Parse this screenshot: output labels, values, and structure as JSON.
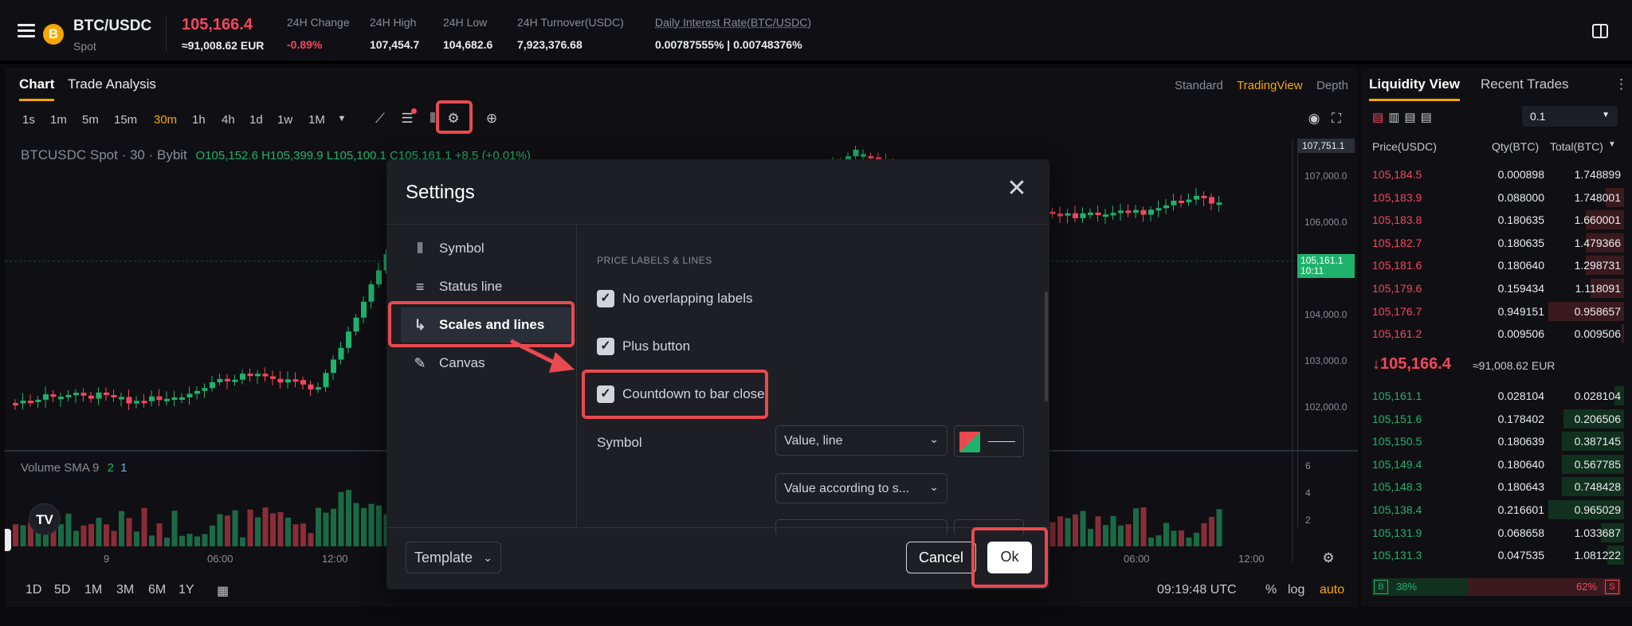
{
  "header": {
    "coin_icon": "B",
    "pair": "BTC/USDC",
    "market": "Spot",
    "price": "105,166.4",
    "price_eur": "≈91,008.62 EUR",
    "stats": [
      {
        "label": "24H Change",
        "value": "-0.89%",
        "color": "#f6465d"
      },
      {
        "label": "24H High",
        "value": "107,454.7",
        "color": "#eaecef"
      },
      {
        "label": "24H Low",
        "value": "104,682.6",
        "color": "#eaecef"
      },
      {
        "label": "24H Turnover(USDC)",
        "value": "7,923,376.68",
        "color": "#eaecef"
      },
      {
        "label": "Daily Interest Rate(BTC/USDC)",
        "value": "0.00787555% | 0.00748376%",
        "color": "#eaecef"
      }
    ]
  },
  "chart": {
    "tabs": [
      "Chart",
      "Trade Analysis"
    ],
    "views": [
      "Standard",
      "TradingView",
      "Depth"
    ],
    "active_view": "TradingView",
    "timeframes": [
      "1s",
      "1m",
      "5m",
      "15m",
      "30m",
      "1h",
      "4h",
      "1d",
      "1w",
      "1M"
    ],
    "active_timeframe": "30m",
    "legend": {
      "symbol": "BTCUSDC Spot · 30 · Bybit",
      "ohlc": "O105,152.6 H105,399.9 L105,100.1 C105,161.1 +8.5 (+0.01%)"
    },
    "price_ticks": [
      "107,000.0",
      "106,000.0",
      "104,000.0",
      "103,000.0",
      "102,000.0"
    ],
    "top_tag": "107,751.1",
    "current_tag_price": "105,161.1",
    "current_tag_time": "10:11",
    "volume_legend": {
      "name": "Volume SMA 9",
      "v1": "2",
      "v2": "1"
    },
    "volume_ticks": [
      "6",
      "4",
      "2"
    ],
    "time_labels": [
      "9",
      "06:00",
      "12:00",
      "06:00",
      "12:00"
    ],
    "ranges": [
      "1D",
      "5D",
      "1M",
      "3M",
      "6M",
      "1Y"
    ],
    "clock": "09:19:48 UTC",
    "scale_options": [
      "%",
      "log",
      "auto"
    ],
    "active_scale": "auto",
    "logo": "TV"
  },
  "settings_modal": {
    "title": "Settings",
    "nav": [
      {
        "label": "Symbol",
        "icon": "candles-icon"
      },
      {
        "label": "Status line",
        "icon": "lines-icon"
      },
      {
        "label": "Scales and lines",
        "icon": "axes-icon"
      },
      {
        "label": "Canvas",
        "icon": "pencil-icon"
      }
    ],
    "active_nav": "Scales and lines",
    "section_title": "PRICE LABELS & LINES",
    "checkboxes": [
      {
        "label": "No overlapping labels",
        "checked": true
      },
      {
        "label": "Plus button",
        "checked": true
      },
      {
        "label": "Countdown to bar close",
        "checked": true
      }
    ],
    "symbol_label": "Symbol",
    "symbol_select": "Value, line",
    "symbol_select2": "Value according to s...",
    "template_label": "Template",
    "cancel_label": "Cancel",
    "ok_label": "Ok"
  },
  "orderbook": {
    "tabs": [
      "Liquidity View",
      "Recent Trades"
    ],
    "precision": "0.1",
    "headers": [
      "Price(USDC)",
      "Qty(BTC)",
      "Total(BTC)"
    ],
    "asks": [
      {
        "price": "105,184.5",
        "qty": "0.000898",
        "total": "1.748899",
        "depth": 0.0
      },
      {
        "price": "105,183.9",
        "qty": "0.088000",
        "total": "1.748001",
        "depth": 0.24
      },
      {
        "price": "105,183.8",
        "qty": "0.180635",
        "total": "1.660001",
        "depth": 0.5
      },
      {
        "price": "105,182.7",
        "qty": "0.180635",
        "total": "1.479366",
        "depth": 0.5
      },
      {
        "price": "105,181.6",
        "qty": "0.180640",
        "total": "1.298731",
        "depth": 0.5
      },
      {
        "price": "105,179.6",
        "qty": "0.159434",
        "total": "1.118091",
        "depth": 0.44
      },
      {
        "price": "105,176.7",
        "qty": "0.949151",
        "total": "0.958657",
        "depth": 1.0
      },
      {
        "price": "105,161.2",
        "qty": "0.009506",
        "total": "0.009506",
        "depth": 0.03
      }
    ],
    "mid_price": "↓105,166.4",
    "mid_eur": "≈91,008.62 EUR",
    "bids": [
      {
        "price": "105,161.1",
        "qty": "0.028104",
        "total": "0.028104",
        "depth": 0.13
      },
      {
        "price": "105,151.6",
        "qty": "0.178402",
        "total": "0.206506",
        "depth": 0.8
      },
      {
        "price": "105,150.5",
        "qty": "0.180639",
        "total": "0.387145",
        "depth": 0.82
      },
      {
        "price": "105,149.4",
        "qty": "0.180640",
        "total": "0.567785",
        "depth": 0.82
      },
      {
        "price": "105,148.3",
        "qty": "0.180643",
        "total": "0.748428",
        "depth": 0.82
      },
      {
        "price": "105,138.4",
        "qty": "0.216601",
        "total": "0.965029",
        "depth": 1.0
      },
      {
        "price": "105,131.9",
        "qty": "0.068658",
        "total": "1.033687",
        "depth": 0.31
      },
      {
        "price": "105,131.3",
        "qty": "0.047535",
        "total": "1.081222",
        "depth": 0.22
      }
    ],
    "buy_badge": "B",
    "buy_pct": "38%",
    "sell_badge": "S",
    "sell_pct": "62%"
  },
  "colors": {
    "accent": "#f7a600",
    "up": "#20b26c",
    "down": "#f6465d",
    "highlight": "#e84a4f"
  }
}
